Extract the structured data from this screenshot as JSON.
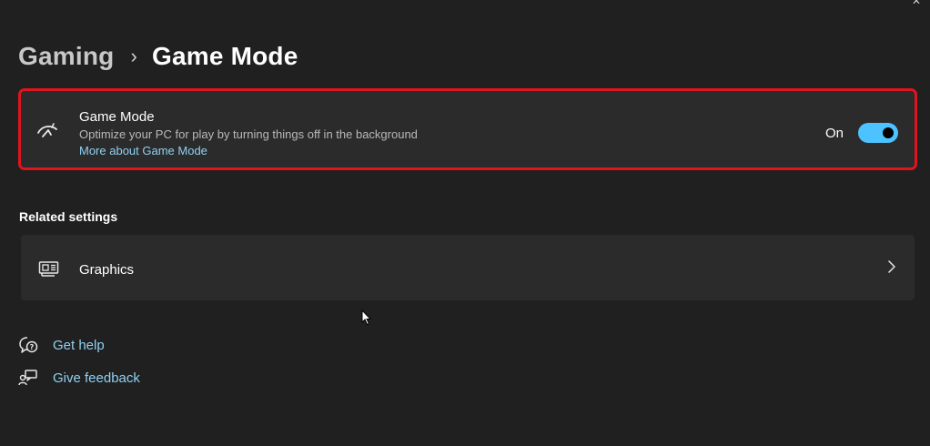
{
  "breadcrumb": {
    "parent": "Gaming",
    "separator": "›",
    "current": "Game Mode"
  },
  "game_mode": {
    "title": "Game Mode",
    "description": "Optimize your PC for play by turning things off in the background",
    "link": "More about Game Mode",
    "toggle_label": "On",
    "toggle_state": true,
    "icon": "game-mode-icon"
  },
  "related": {
    "title": "Related settings",
    "graphics_label": "Graphics",
    "graphics_icon": "graphics-card-icon"
  },
  "help": {
    "get_help": "Get help",
    "give_feedback": "Give feedback"
  },
  "colors": {
    "background": "#202020",
    "card": "#2b2b2b",
    "accent": "#4cc2ff",
    "link": "#8fd0f2",
    "highlight": "#e0141e"
  }
}
